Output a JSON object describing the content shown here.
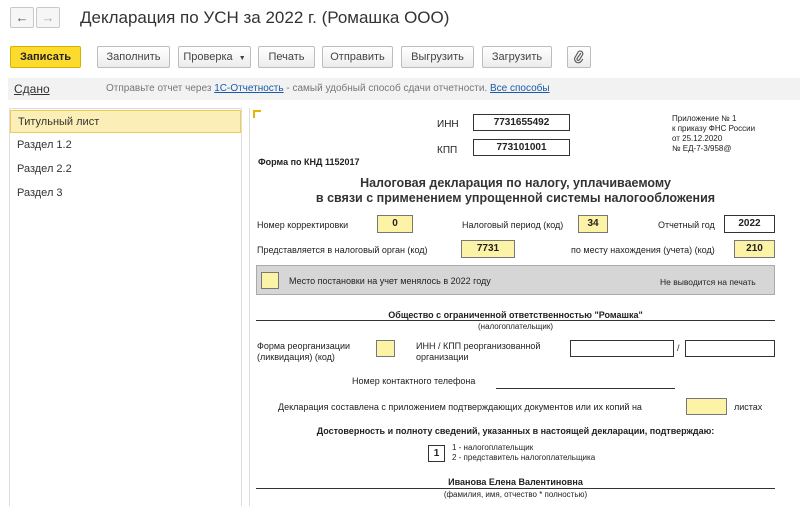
{
  "window": {
    "title": "Декларация по УСН за 2022 г. (Ромашка ООО)",
    "back_icon": "arrow-left-icon",
    "forward_icon": "arrow-right-icon"
  },
  "toolbar": {
    "record": "Записать",
    "fill": "Заполнить",
    "check": "Проверка",
    "print": "Печать",
    "send": "Отправить",
    "upload": "Выгрузить",
    "load": "Загрузить",
    "attach_icon": "paperclip-icon"
  },
  "infobar": {
    "status": "Сдано",
    "msg_before": "Отправьте отчет через ",
    "msg_link": "1С-Отчетность",
    "msg_middle": " - самый удобный способ сдачи отчетности. ",
    "msg_link2": "Все способы"
  },
  "sidebar": {
    "items": [
      {
        "label": "Титульный лист"
      },
      {
        "label": "Раздел 1.2"
      },
      {
        "label": "Раздел 2.2"
      },
      {
        "label": "Раздел 3"
      }
    ]
  },
  "form": {
    "inn_label": "ИНН",
    "inn": "7731655492",
    "kpp_label": "КПП",
    "kpp": "773101001",
    "appendix_1": "Приложение № 1",
    "appendix_2": "к приказу ФНС России",
    "appendix_3": "от 25.12.2020",
    "appendix_4": "№ ЕД-7-3/958@",
    "knd": "Форма по КНД 1152017",
    "heading_1": "Налоговая декларация по налогу, уплачиваемому",
    "heading_2": "в связи с применением упрощенной системы налогообложения",
    "correction_label": "Номер корректировки",
    "correction": "0",
    "period_label": "Налоговый период (код)",
    "period": "34",
    "year_label": "Отчетный год",
    "year": "2022",
    "tax_office_label": "Представляется в налоговый орган (код)",
    "tax_office": "7731",
    "location_label": "по месту нахождения (учета) (код)",
    "location": "210",
    "registration_changed": "Место постановки на учет менялось в 2022 году",
    "not_printed": "Не выводится на печать",
    "org_name": "Общество с ограниченной ответственностью \"Ромашка\"",
    "org_caption": "(налогоплательщик)",
    "reorg_label_1": "Форма реорганизации",
    "reorg_label_2": "(ликвидация) (код)",
    "reorg_inn_label_1": "ИНН / КПП реорганизованной",
    "reorg_inn_label_2": "организации",
    "slash": "/",
    "phone_label": "Номер контактного телефона",
    "pages_label": "Декларация составлена с приложением подтверждающих документов или их копий на",
    "pages_suffix": "листах",
    "confirm_heading": "Достоверность и полноту сведений, указанных в настоящей декларации, подтверждаю:",
    "signer_code": "1",
    "signer_opt_1": "1 - налогоплательщик",
    "signer_opt_2": "2 - представитель налогоплательщика",
    "signer_name": "Иванова Елена Валентиновна",
    "signer_caption": "(фамилия, имя, отчество * полностью)"
  }
}
